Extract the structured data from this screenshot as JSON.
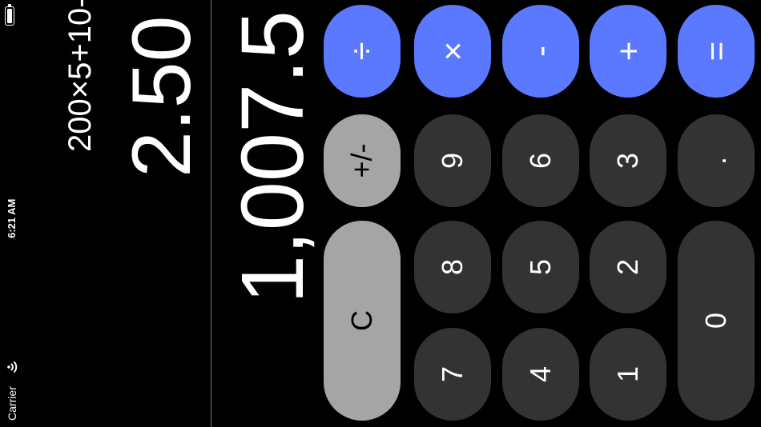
{
  "status_bar": {
    "time": "6:21 AM",
    "carrier": "Carrier"
  },
  "display": {
    "expression": "200×5+10-",
    "memory_value": "2.50",
    "result": "1,007.5"
  },
  "keys": {
    "operators": {
      "divide": "÷",
      "multiply": "×",
      "minus": "-",
      "plus": "+",
      "equals": "="
    },
    "plus_minus": "+/-",
    "clear": "C",
    "digits": {
      "d0": "0",
      "d1": "1",
      "d2": "2",
      "d3": "3",
      "d4": "4",
      "d5": "5",
      "d6": "6",
      "d7": "7",
      "d8": "8",
      "d9": "9"
    },
    "decimal": "."
  },
  "colors": {
    "operator": "#5b79ff",
    "digit": "#333333",
    "function": "#a5a5a5",
    "background": "#000000"
  },
  "icons": {
    "battery": "battery-icon",
    "wifi": "wifi-icon"
  }
}
